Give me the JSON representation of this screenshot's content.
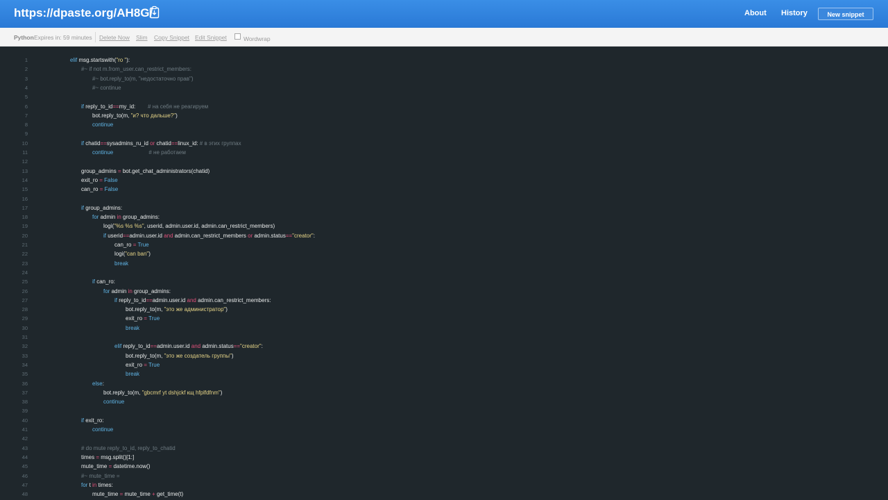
{
  "header": {
    "url": "https://dpaste.org/AH8G/",
    "nav": [
      "About",
      "History"
    ],
    "new_snippet": "New snippet"
  },
  "toolbar": {
    "language": "Python",
    "expires": "Expires in: 59 minutes",
    "links": [
      "Delete Now",
      "Slim",
      "Copy Snippet",
      "Edit Snippet"
    ],
    "wordwrap": "Wordwrap"
  },
  "code": [
    {
      "n": "1",
      "i": 0,
      "t": [
        [
          "elif",
          "kw"
        ],
        [
          " msg.startswith(",
          ""
        ],
        [
          "\"ro \"",
          "st"
        ],
        [
          "):",
          ""
        ]
      ]
    },
    {
      "n": "2",
      "i": 1,
      "t": [
        [
          "#~ if not m.from_user.can_restrict_members:",
          "cm"
        ]
      ]
    },
    {
      "n": "3",
      "i": 2,
      "t": [
        [
          "#~ bot.reply_to(m, \"недостаточно прав\")",
          "cm"
        ]
      ]
    },
    {
      "n": "4",
      "i": 2,
      "t": [
        [
          "#~ continue",
          "cm"
        ]
      ]
    },
    {
      "n": "5",
      "i": 0,
      "t": []
    },
    {
      "n": "6",
      "i": 1,
      "t": [
        [
          "if",
          "kw"
        ],
        [
          " reply_to_id",
          ""
        ],
        [
          "==",
          "op"
        ],
        [
          "my_id:        ",
          ""
        ],
        [
          "# на себя не реагируем",
          "cm"
        ]
      ]
    },
    {
      "n": "7",
      "i": 2,
      "t": [
        [
          "bot.reply_to(m, ",
          ""
        ],
        [
          "\"и? что дальше?\"",
          "st"
        ],
        [
          ")",
          ""
        ]
      ]
    },
    {
      "n": "8",
      "i": 2,
      "t": [
        [
          "continue",
          "kw"
        ]
      ]
    },
    {
      "n": "9",
      "i": 0,
      "t": []
    },
    {
      "n": "10",
      "i": 1,
      "t": [
        [
          "if",
          "kw"
        ],
        [
          " chatid",
          ""
        ],
        [
          "==",
          "op"
        ],
        [
          "sysadmins_ru_id ",
          ""
        ],
        [
          "or",
          "op"
        ],
        [
          " chatid",
          ""
        ],
        [
          "==",
          "op"
        ],
        [
          "linux_id: ",
          ""
        ],
        [
          "# в этих группах",
          "cm"
        ]
      ]
    },
    {
      "n": "11",
      "i": 2,
      "t": [
        [
          "continue",
          "kw"
        ],
        [
          "                       ",
          ""
        ],
        [
          "# не работаем",
          "cm"
        ]
      ]
    },
    {
      "n": "12",
      "i": 0,
      "t": []
    },
    {
      "n": "13",
      "i": 1,
      "t": [
        [
          "group_admins ",
          ""
        ],
        [
          "=",
          "op"
        ],
        [
          " bot.get_chat_administrators(chatid)",
          ""
        ]
      ]
    },
    {
      "n": "14",
      "i": 1,
      "t": [
        [
          "exit_ro ",
          ""
        ],
        [
          "=",
          "op"
        ],
        [
          " ",
          ""
        ],
        [
          "False",
          "kw"
        ]
      ]
    },
    {
      "n": "15",
      "i": 1,
      "t": [
        [
          "can_ro ",
          ""
        ],
        [
          "=",
          "op"
        ],
        [
          " ",
          ""
        ],
        [
          "False",
          "kw"
        ]
      ]
    },
    {
      "n": "16",
      "i": 0,
      "t": []
    },
    {
      "n": "17",
      "i": 1,
      "t": [
        [
          "if",
          "kw"
        ],
        [
          " group_admins:",
          ""
        ]
      ]
    },
    {
      "n": "18",
      "i": 2,
      "t": [
        [
          "for",
          "kw"
        ],
        [
          " admin ",
          ""
        ],
        [
          "in",
          "op"
        ],
        [
          " group_admins:",
          ""
        ]
      ]
    },
    {
      "n": "19",
      "i": 3,
      "t": [
        [
          "logi(",
          ""
        ],
        [
          "\"%s %s %s\"",
          "st"
        ],
        [
          ", userid, admin.user.id, admin.can_restrict_members)",
          ""
        ]
      ]
    },
    {
      "n": "20",
      "i": 3,
      "t": [
        [
          "if",
          "kw"
        ],
        [
          " userid",
          ""
        ],
        [
          "==",
          "op"
        ],
        [
          "admin.user.id ",
          ""
        ],
        [
          "and",
          "op"
        ],
        [
          " admin.can_restrict_members ",
          ""
        ],
        [
          "or",
          "op"
        ],
        [
          " admin.status",
          ""
        ],
        [
          "==",
          "op"
        ],
        [
          "\"creator\"",
          "st"
        ],
        [
          ":",
          ""
        ]
      ]
    },
    {
      "n": "21",
      "i": 4,
      "t": [
        [
          "can_ro ",
          ""
        ],
        [
          "=",
          "op"
        ],
        [
          " ",
          ""
        ],
        [
          "True",
          "kw"
        ]
      ]
    },
    {
      "n": "22",
      "i": 4,
      "t": [
        [
          "logi(",
          ""
        ],
        [
          "\"can ban\"",
          "st"
        ],
        [
          ")",
          ""
        ]
      ]
    },
    {
      "n": "23",
      "i": 4,
      "t": [
        [
          "break",
          "kw"
        ]
      ]
    },
    {
      "n": "24",
      "i": 0,
      "t": []
    },
    {
      "n": "25",
      "i": 2,
      "t": [
        [
          "if",
          "kw"
        ],
        [
          " can_ro:",
          ""
        ]
      ]
    },
    {
      "n": "26",
      "i": 3,
      "t": [
        [
          "for",
          "kw"
        ],
        [
          " admin ",
          ""
        ],
        [
          "in",
          "op"
        ],
        [
          " group_admins:",
          ""
        ]
      ]
    },
    {
      "n": "27",
      "i": 4,
      "t": [
        [
          "if",
          "kw"
        ],
        [
          " reply_to_id",
          ""
        ],
        [
          "==",
          "op"
        ],
        [
          "admin.user.id ",
          ""
        ],
        [
          "and",
          "op"
        ],
        [
          " admin.can_restrict_members:",
          ""
        ]
      ]
    },
    {
      "n": "28",
      "i": 5,
      "t": [
        [
          "bot.reply_to(m, ",
          ""
        ],
        [
          "\"это же администратор\"",
          "st"
        ],
        [
          ")",
          ""
        ]
      ]
    },
    {
      "n": "29",
      "i": 5,
      "t": [
        [
          "exit_ro ",
          ""
        ],
        [
          "=",
          "op"
        ],
        [
          " ",
          ""
        ],
        [
          "True",
          "kw"
        ]
      ]
    },
    {
      "n": "30",
      "i": 5,
      "t": [
        [
          "break",
          "kw"
        ]
      ]
    },
    {
      "n": "31",
      "i": 0,
      "t": []
    },
    {
      "n": "32",
      "i": 4,
      "t": [
        [
          "elif",
          "kw"
        ],
        [
          " reply_to_id",
          ""
        ],
        [
          "==",
          "op"
        ],
        [
          "admin.user.id ",
          ""
        ],
        [
          "and",
          "op"
        ],
        [
          " admin.status",
          ""
        ],
        [
          "==",
          "op"
        ],
        [
          "\"creator\"",
          "st"
        ],
        [
          ":",
          ""
        ]
      ]
    },
    {
      "n": "33",
      "i": 5,
      "t": [
        [
          "bot.reply_to(m, ",
          ""
        ],
        [
          "\"это же создатель группы\"",
          "st"
        ],
        [
          ")",
          ""
        ]
      ]
    },
    {
      "n": "34",
      "i": 5,
      "t": [
        [
          "exit_ro ",
          ""
        ],
        [
          "=",
          "op"
        ],
        [
          " ",
          ""
        ],
        [
          "True",
          "kw"
        ]
      ]
    },
    {
      "n": "35",
      "i": 5,
      "t": [
        [
          "break",
          "kw"
        ]
      ]
    },
    {
      "n": "36",
      "i": 2,
      "t": [
        [
          "else",
          "kw"
        ],
        [
          ":",
          ""
        ]
      ]
    },
    {
      "n": "37",
      "i": 3,
      "t": [
        [
          "bot.reply_to(m, ",
          ""
        ],
        [
          "\"gbcmrf yt dshjckf кщ hfplfdfnm\"",
          "st"
        ],
        [
          ")",
          ""
        ]
      ]
    },
    {
      "n": "38",
      "i": 3,
      "t": [
        [
          "continue",
          "kw"
        ]
      ]
    },
    {
      "n": "39",
      "i": 0,
      "t": []
    },
    {
      "n": "40",
      "i": 1,
      "t": [
        [
          "if",
          "kw"
        ],
        [
          " exit_ro:",
          ""
        ]
      ]
    },
    {
      "n": "41",
      "i": 2,
      "t": [
        [
          "continue",
          "kw"
        ]
      ]
    },
    {
      "n": "42",
      "i": 0,
      "t": []
    },
    {
      "n": "43",
      "i": 1,
      "t": [
        [
          "# do mute reply_to_id, reply_to_chatid",
          "cm"
        ]
      ]
    },
    {
      "n": "44",
      "i": 1,
      "t": [
        [
          "times ",
          ""
        ],
        [
          "=",
          "op"
        ],
        [
          " msg.split()[1:]",
          ""
        ]
      ]
    },
    {
      "n": "45",
      "i": 1,
      "t": [
        [
          "mute_time ",
          ""
        ],
        [
          "=",
          "op"
        ],
        [
          " datetime.now()",
          ""
        ]
      ]
    },
    {
      "n": "46",
      "i": 1,
      "t": [
        [
          "#~ mute_time =",
          "cm"
        ]
      ]
    },
    {
      "n": "47",
      "i": 1,
      "t": [
        [
          "for",
          "kw"
        ],
        [
          " t ",
          ""
        ],
        [
          "in",
          "op"
        ],
        [
          " times:",
          ""
        ]
      ]
    },
    {
      "n": "48",
      "i": 2,
      "t": [
        [
          "mute_time ",
          ""
        ],
        [
          "=",
          "op"
        ],
        [
          " mute_time ",
          ""
        ],
        [
          "+",
          "op"
        ],
        [
          " get_time(t)",
          ""
        ]
      ]
    }
  ]
}
